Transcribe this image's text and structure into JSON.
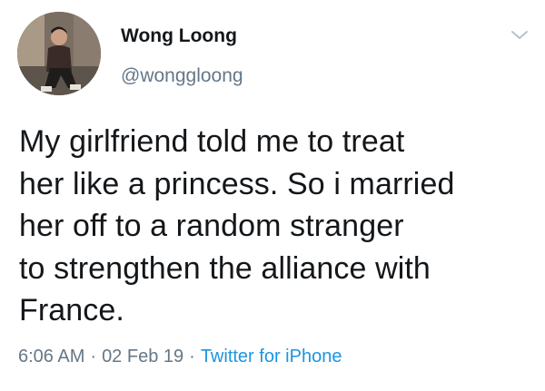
{
  "user": {
    "display_name": "Wong Loong",
    "handle": "@wonggloong"
  },
  "tweet": {
    "lines": [
      "My girlfriend told me to treat",
      "her like a princess. So i married",
      "her off to a random stranger",
      "to strengthen the alliance with",
      "France."
    ]
  },
  "meta": {
    "time": "6:06 AM",
    "separator": "·",
    "date": "02 Feb 19",
    "source": "Twitter for iPhone"
  },
  "icons": {
    "menu": "chevron-down-icon"
  },
  "colors": {
    "text": "#14171a",
    "secondary": "#657786",
    "link": "#1b95e0"
  }
}
